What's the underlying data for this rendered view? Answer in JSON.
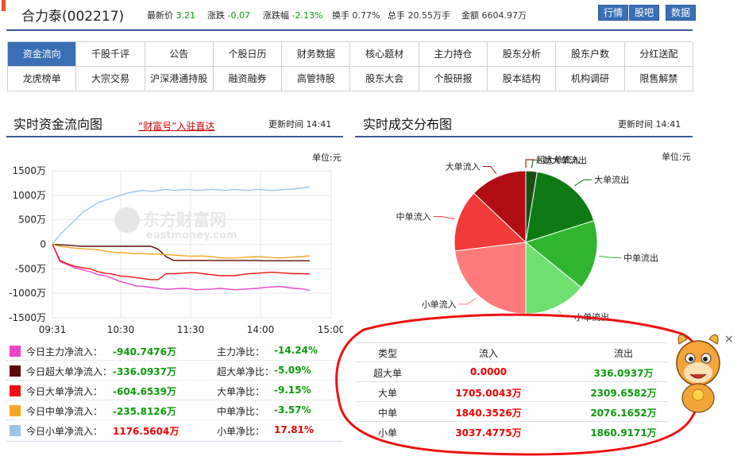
{
  "header": {
    "stock_name": "合力泰(002217)",
    "quote": [
      {
        "label": "最新价",
        "value": "3.21"
      },
      {
        "label": "涨跌",
        "value": "-0.07"
      },
      {
        "label": "涨跌幅",
        "value": "-2.13%"
      },
      {
        "label": "换手",
        "value": "0.77%"
      },
      {
        "label": "总手",
        "value": "20.55万手"
      },
      {
        "label": "金额",
        "value": "6604.97万"
      }
    ],
    "buttons": [
      "行情",
      "股吧",
      "数据"
    ]
  },
  "nav": {
    "row1": [
      "资金流向",
      "千股千评",
      "公告",
      "个股日历",
      "财务数据",
      "核心题材",
      "主力持仓",
      "股东分析",
      "股东户数",
      "分红送配"
    ],
    "row2": [
      "龙虎榜单",
      "大宗交易",
      "沪深港通持股",
      "融资融券",
      "高管持股",
      "股东大会",
      "个股研报",
      "股本结构",
      "机构调研",
      "限售解禁"
    ]
  },
  "flow_section": {
    "title": "实时资金流向图",
    "promo": "“财富号”入驻直达",
    "update_label": "更新时间",
    "update_time": "14:41",
    "unit": "单位:元",
    "watermark_cn": "东方财富网",
    "watermark_en": "eastmoney.com"
  },
  "dist_section": {
    "title": "实时成交分布图",
    "update_label": "更新时间",
    "update_time": "14:41",
    "unit": "单位:元"
  },
  "legend": [
    {
      "label": "今日主力净流入：",
      "value": "-940.7476万",
      "value_color": "green",
      "ratio_label": "主力净比：",
      "ratio": "-14.24%",
      "ratio_color": "green",
      "color": "#ee44cc"
    },
    {
      "label": "今日超大单净流入：",
      "value": "-336.0937万",
      "value_color": "green",
      "ratio_label": "超大单净比：",
      "ratio": "-5.09%",
      "ratio_color": "green",
      "color": "#5c0a0a"
    },
    {
      "label": "今日大单净流入：",
      "value": "-604.6539万",
      "value_color": "green",
      "ratio_label": "大单净比：",
      "ratio": "-9.15%",
      "ratio_color": "green",
      "color": "#ee1111"
    },
    {
      "label": "今日中单净流入：",
      "value": "-235.8126万",
      "value_color": "green",
      "ratio_label": "中单净比：",
      "ratio": "-3.57%",
      "ratio_color": "green",
      "color": "#f5a623"
    },
    {
      "label": "今日小单净流入：",
      "value": "1176.5604万",
      "value_color": "red",
      "ratio_label": "小单净比：",
      "ratio": "17.81%",
      "ratio_color": "red",
      "color": "#9ec4ea"
    }
  ],
  "table": {
    "headers": [
      "类型",
      "流入",
      "流出"
    ],
    "rows": [
      {
        "type": "超大单",
        "in": "0.0000",
        "out": "336.0937万"
      },
      {
        "type": "大单",
        "in": "1705.0043万",
        "out": "2309.6582万"
      },
      {
        "type": "中单",
        "in": "1840.3526万",
        "out": "2076.1652万"
      },
      {
        "type": "小单",
        "in": "3037.4775万",
        "out": "1860.9171万"
      }
    ]
  },
  "close_glyph": "×",
  "chart_data": [
    {
      "type": "line",
      "title": "实时资金流向图",
      "x_ticks": [
        "09:31",
        "10:30",
        "11:30",
        "14:00",
        "15:00"
      ],
      "y_ticks": [
        "1500万",
        "1000万",
        "500万",
        "0",
        "-500万",
        "-1000万",
        "-1500万"
      ],
      "ylim": [
        -1500,
        1500
      ],
      "y_unit": "万",
      "series": [
        {
          "name": "今日主力净流入",
          "color": "#ee44cc",
          "values": [
            0,
            -350,
            -420,
            -480,
            -520,
            -560,
            -620,
            -640,
            -700,
            -760,
            -800,
            -850,
            -860,
            -880,
            -900,
            -920,
            -910,
            -900,
            -905,
            -930,
            -920,
            -915,
            -900,
            -910,
            -930,
            -920,
            -910,
            -900,
            -880,
            -870,
            -860,
            -880,
            -900,
            -910,
            -940
          ]
        },
        {
          "name": "今日超大单净流入",
          "color": "#5c0a0a",
          "values": [
            0,
            -10,
            -20,
            -30,
            -40,
            -40,
            -40,
            -40,
            -40,
            -40,
            -40,
            -40,
            -40,
            -40,
            -100,
            -250,
            -330,
            -330,
            -330,
            -330,
            -330,
            -330,
            -330,
            -330,
            -330,
            -330,
            -330,
            -330,
            -336,
            -336,
            -336,
            -336,
            -336,
            -336,
            -336
          ]
        },
        {
          "name": "今日大单净流入",
          "color": "#ee1111",
          "values": [
            0,
            -330,
            -400,
            -450,
            -480,
            -500,
            -560,
            -590,
            -610,
            -650,
            -660,
            -680,
            -700,
            -720,
            -720,
            -600,
            -600,
            -590,
            -580,
            -580,
            -600,
            -620,
            -640,
            -640,
            -640,
            -620,
            -600,
            -590,
            -580,
            -570,
            -580,
            -590,
            -600,
            -600,
            -605
          ]
        },
        {
          "name": "今日中单净流入",
          "color": "#f5a623",
          "values": [
            0,
            -40,
            -60,
            -80,
            -90,
            -100,
            -110,
            -140,
            -160,
            -170,
            -180,
            -190,
            -190,
            -200,
            -200,
            -210,
            -220,
            -230,
            -240,
            -240,
            -240,
            -250,
            -270,
            -280,
            -280,
            -270,
            -260,
            -250,
            -260,
            -270,
            -280,
            -270,
            -260,
            -250,
            -236
          ]
        },
        {
          "name": "今日小单净流入",
          "color": "#9ec4ea",
          "values": [
            0,
            200,
            350,
            500,
            650,
            750,
            850,
            900,
            950,
            1000,
            1050,
            1080,
            1100,
            1080,
            1100,
            1120,
            1100,
            1110,
            1120,
            1100,
            1110,
            1120,
            1110,
            1100,
            1120,
            1110,
            1100,
            1120,
            1110,
            1100,
            1110,
            1120,
            1130,
            1150,
            1176
          ]
        }
      ],
      "watermark": "东方财富网"
    },
    {
      "type": "pie",
      "title": "实时成交分布图",
      "slices": [
        {
          "label": "超大单流出",
          "value": 336.0937,
          "color": "#1a4d12"
        },
        {
          "label": "大单流出",
          "value": 2309.6582,
          "color": "#0e7a14"
        },
        {
          "label": "中单流出",
          "value": 2076.1652,
          "color": "#2fb52f"
        },
        {
          "label": "小单流出",
          "value": 1860.9171,
          "color": "#6fe06f"
        },
        {
          "label": "小单流入",
          "value": 3037.4775,
          "color": "#ff7b7b"
        },
        {
          "label": "中单流入",
          "value": 1840.3526,
          "color": "#f33a3a"
        },
        {
          "label": "大单流入",
          "value": 1705.0043,
          "color": "#b00e14"
        },
        {
          "label": "超大单流入",
          "value": 0.0,
          "color": "#7a0000"
        }
      ]
    }
  ]
}
